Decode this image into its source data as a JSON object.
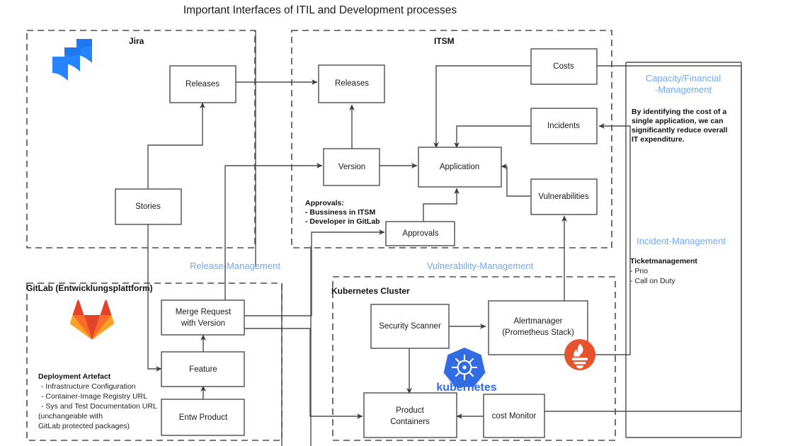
{
  "title": "Important Interfaces of ITIL and Development processes",
  "groups": [
    {
      "id": "jira",
      "label": "Jira",
      "logo": "jira-logo"
    },
    {
      "id": "itsm",
      "label": "ITSM",
      "logo": null
    },
    {
      "id": "gitlab",
      "label": "GitLab (Entwicklungsplattform)",
      "logo": "gitlab-logo"
    },
    {
      "id": "kubernetes",
      "label": "Kubernetes Cluster",
      "logo": "kubernetes-logo"
    }
  ],
  "nodes": [
    {
      "id": "jira-releases",
      "label": "Releases"
    },
    {
      "id": "jira-stories",
      "label": "Stories"
    },
    {
      "id": "itsm-releases",
      "label": "Releases"
    },
    {
      "id": "itsm-version",
      "label": "Version"
    },
    {
      "id": "itsm-application",
      "label": "Application"
    },
    {
      "id": "itsm-approvals",
      "label": "Approvals"
    },
    {
      "id": "itsm-costs",
      "label": "Costs"
    },
    {
      "id": "itsm-incidents",
      "label": "Incidents"
    },
    {
      "id": "itsm-vulnerabilities",
      "label": "Vulnerabilities"
    },
    {
      "id": "gitlab-merge",
      "label_line1": "Merge Request",
      "label_line2": "with Version"
    },
    {
      "id": "gitlab-feature",
      "label": "Feature"
    },
    {
      "id": "gitlab-entw",
      "label": "Entw Product"
    },
    {
      "id": "k8s-scanner",
      "label": "Security Scanner"
    },
    {
      "id": "k8s-alertmanager",
      "label_line1": "Alertmanager",
      "label_line2": "(Prometheus Stack)"
    },
    {
      "id": "k8s-containers",
      "label_line1": "Product",
      "label_line2": "Containers"
    },
    {
      "id": "k8s-costmonitor",
      "label": "cost Monitor"
    }
  ],
  "swimlanes": [
    {
      "id": "release-management",
      "label": "Release-Management"
    },
    {
      "id": "vulnerability-management",
      "label": "Vulnerability-Management"
    },
    {
      "id": "capacity-financial",
      "label_line1": "Capacity/Financial",
      "label_line2": "-Management"
    },
    {
      "id": "incident-management",
      "label": "Incident-Management"
    }
  ],
  "notes": {
    "approvals": {
      "heading": "Approvals:",
      "items": [
        "- Bussiness in ITSM",
        "- Developer in GitLab"
      ]
    },
    "deployment": {
      "heading": "Deployment Artefact",
      "items": [
        "- Infrastructure Configuration",
        "- Container-Image Registry URL",
        "- Sys and Test Documentation URL",
        "(unchangeable with",
        "GitLab protected packages)"
      ]
    },
    "capacity": {
      "lines": [
        "By identifying the cost of a",
        "single application, we can",
        "significantly reduce overall",
        "IT expenditure."
      ]
    },
    "ticket": {
      "heading": "Ticketmanagement",
      "items": [
        "- Prio",
        "- Call on Duty"
      ]
    }
  },
  "branding": {
    "kubernetes_wordmark": "kubernetes"
  },
  "colors": {
    "swimlane_blue": "#6fa8f5",
    "kubernetes_blue": "#326ce5",
    "jira_blue": "#2684ff",
    "gitlab_orange": "#fc6d26",
    "gitlab_red": "#e24329",
    "prometheus_orange": "#e6522c",
    "stroke": "#4d4d4d"
  }
}
